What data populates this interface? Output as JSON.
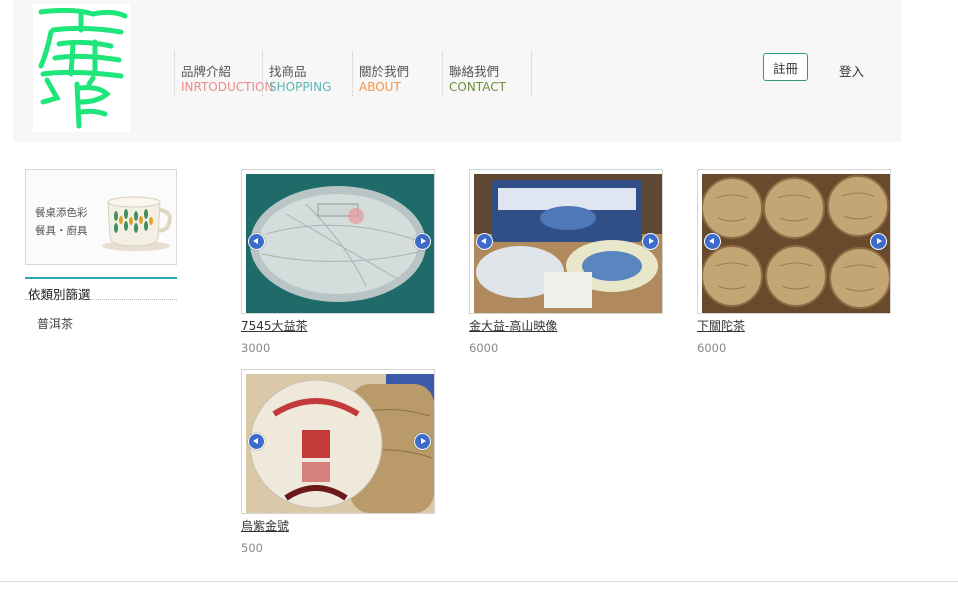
{
  "nav": [
    {
      "zh": "品牌介紹",
      "en": "INRTODUCTION",
      "en_color": "#f08a8a"
    },
    {
      "zh": "找商品",
      "en": "SHOPPING",
      "en_color": "#5bb7b0"
    },
    {
      "zh": "關於我們",
      "en": "ABOUT",
      "en_color": "#f0954a"
    },
    {
      "zh": "聯絡我們",
      "en": "CONTACT",
      "en_color": "#6f8f3c"
    }
  ],
  "auth": {
    "register": "註冊",
    "login": "登入"
  },
  "banner": {
    "line1": "餐桌添色彩",
    "line2": "餐具・廚具"
  },
  "filter": {
    "title": "依類別篩選",
    "items": [
      "普洱茶"
    ]
  },
  "products": [
    {
      "name": "7545大益茶",
      "price": "3000"
    },
    {
      "name": "金大益-高山映像",
      "price": "6000"
    },
    {
      "name": "下關陀茶",
      "price": "6000"
    },
    {
      "name": "烏紫金號",
      "price": "500"
    }
  ],
  "colors": {
    "logo": "#1ee67a",
    "register_border": "#2e9e6b",
    "filter_accent": "#2aa6b8",
    "header_bg": "#f7f7f8"
  }
}
